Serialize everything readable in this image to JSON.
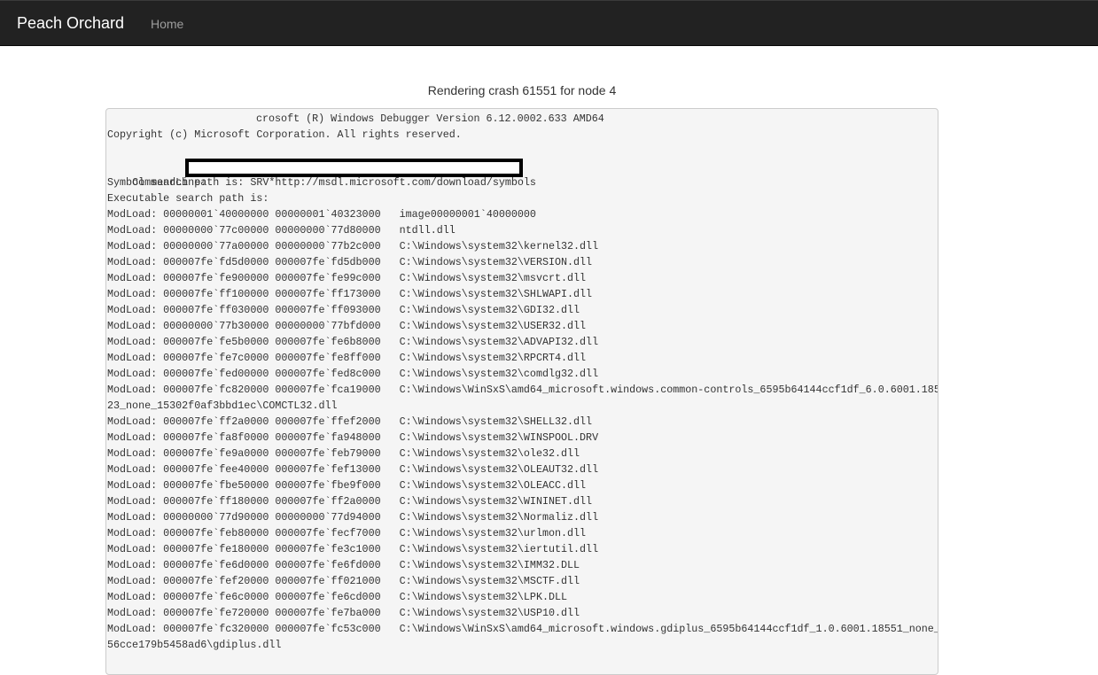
{
  "navbar": {
    "brand": "Peach Orchard",
    "home_link": "Home",
    "background": "#222222"
  },
  "page": {
    "title": "Rendering crash 61551 for node 4"
  },
  "debugger_output": {
    "header_line": "crosoft (R) Windows Debugger Version 6.12.0002.633 AMD64",
    "copyright": "Copyright (c) Microsoft Corporation. All rights reserved.",
    "blank": "",
    "commandline_label": "CommandLine: ",
    "symbol_path": "Symbol search path is: SRV*http://msdl.microsoft.com/download/symbols",
    "executable_path": "Executable search path is:",
    "modloads": [
      "ModLoad: 00000001`40000000 00000001`40323000   image00000001`40000000",
      "ModLoad: 00000000`77c00000 00000000`77d80000   ntdll.dll",
      "ModLoad: 00000000`77a00000 00000000`77b2c000   C:\\Windows\\system32\\kernel32.dll",
      "ModLoad: 000007fe`fd5d0000 000007fe`fd5db000   C:\\Windows\\system32\\VERSION.dll",
      "ModLoad: 000007fe`fe900000 000007fe`fe99c000   C:\\Windows\\system32\\msvcrt.dll",
      "ModLoad: 000007fe`ff100000 000007fe`ff173000   C:\\Windows\\system32\\SHLWAPI.dll",
      "ModLoad: 000007fe`ff030000 000007fe`ff093000   C:\\Windows\\system32\\GDI32.dll",
      "ModLoad: 00000000`77b30000 00000000`77bfd000   C:\\Windows\\system32\\USER32.dll",
      "ModLoad: 000007fe`fe5b0000 000007fe`fe6b8000   C:\\Windows\\system32\\ADVAPI32.dll",
      "ModLoad: 000007fe`fe7c0000 000007fe`fe8ff000   C:\\Windows\\system32\\RPCRT4.dll",
      "ModLoad: 000007fe`fed00000 000007fe`fed8c000   C:\\Windows\\system32\\comdlg32.dll",
      "ModLoad: 000007fe`fc820000 000007fe`fca19000   C:\\Windows\\WinSxS\\amd64_microsoft.windows.common-controls_6595b64144ccf1df_6.0.6001.185",
      "23_none_15302f0af3bbd1ec\\COMCTL32.dll",
      "ModLoad: 000007fe`ff2a0000 000007fe`ffef2000   C:\\Windows\\system32\\SHELL32.dll",
      "ModLoad: 000007fe`fa8f0000 000007fe`fa948000   C:\\Windows\\system32\\WINSPOOL.DRV",
      "ModLoad: 000007fe`fe9a0000 000007fe`feb79000   C:\\Windows\\system32\\ole32.dll",
      "ModLoad: 000007fe`fee40000 000007fe`fef13000   C:\\Windows\\system32\\OLEAUT32.dll",
      "ModLoad: 000007fe`fbe50000 000007fe`fbe9f000   C:\\Windows\\system32\\OLEACC.dll",
      "ModLoad: 000007fe`ff180000 000007fe`ff2a0000   C:\\Windows\\system32\\WININET.dll",
      "ModLoad: 00000000`77d90000 00000000`77d94000   C:\\Windows\\system32\\Normaliz.dll",
      "ModLoad: 000007fe`feb80000 000007fe`fecf7000   C:\\Windows\\system32\\urlmon.dll",
      "ModLoad: 000007fe`fe180000 000007fe`fe3c1000   C:\\Windows\\system32\\iertutil.dll",
      "ModLoad: 000007fe`fe6d0000 000007fe`fe6fd000   C:\\Windows\\system32\\IMM32.DLL",
      "ModLoad: 000007fe`fef20000 000007fe`ff021000   C:\\Windows\\system32\\MSCTF.dll",
      "ModLoad: 000007fe`fe6c0000 000007fe`fe6cd000   C:\\Windows\\system32\\LPK.DLL",
      "ModLoad: 000007fe`fe720000 000007fe`fe7ba000   C:\\Windows\\system32\\USP10.dll",
      "ModLoad: 000007fe`fc320000 000007fe`fc53c000   C:\\Windows\\WinSxS\\amd64_microsoft.windows.gdiplus_6595b64144ccf1df_1.0.6001.18551_none_",
      "56cce179b5458ad6\\gdiplus.dll"
    ]
  }
}
